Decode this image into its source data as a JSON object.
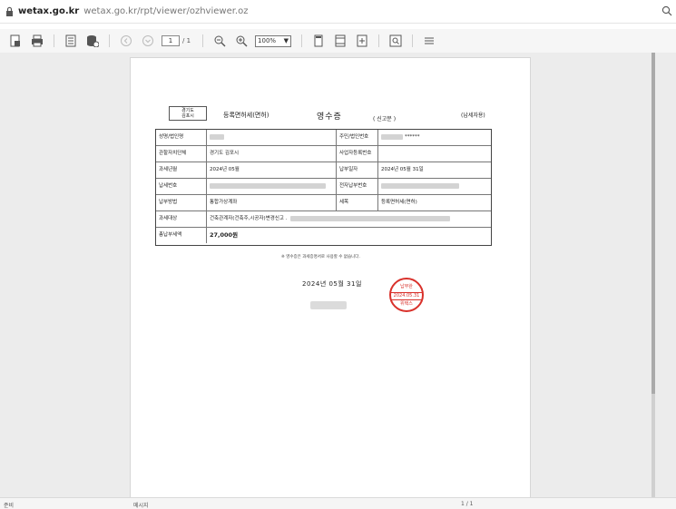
{
  "address_bar": {
    "host": "wetax.go.kr",
    "path": "wetax.go.kr/rpt/viewer/ozhviewer.oz"
  },
  "toolbar": {
    "icons": [
      "export-icon",
      "print-icon",
      "save-icon",
      "save-db-icon",
      "prev-page-icon",
      "next-page-icon",
      "zoom-out-icon",
      "zoom-in-icon",
      "single-page-icon",
      "two-page-icon",
      "fit-page-icon",
      "find-icon",
      "menu-icon"
    ],
    "page_current": "1",
    "page_total": "/ 1",
    "zoom": "100%"
  },
  "receipt": {
    "issuer_line1": "경기도",
    "issuer_line2": "김포시",
    "tax_name": "등록면허세(면허)",
    "title": "영수증",
    "subtitle": "( 신고분 )",
    "copy_type": "(납세자용)",
    "rows": [
      {
        "label": "성명/법인명",
        "value": "",
        "label2": "주민/법인번호",
        "value2": "******"
      },
      {
        "label": "관할자치단체",
        "value": "경기도 김포시",
        "label2": "사업자등록번호",
        "value2": ""
      },
      {
        "label": "과세년월",
        "value": "2024년 05월",
        "label2": "납부일자",
        "value2": "2024년 05월 31일"
      },
      {
        "label": "납세번호",
        "value": "",
        "label2": "전자납부번호",
        "value2": ""
      },
      {
        "label": "납부방법",
        "value": "통합가상계좌",
        "label2": "세목",
        "value2": "등록면허세(면허)"
      },
      {
        "label": "과세대상",
        "value": "건축관계자(건축주,시공자)변경신고 ."
      },
      {
        "label": "총납부세액",
        "value": "27,000원"
      }
    ],
    "note": "※ 영수증은 과세증명서로 사용할 수 없습니다.",
    "issue_date": "2024년 05월 31일",
    "seal": {
      "top": "납부완",
      "date": "2024.05.31",
      "bottom": "위택스"
    }
  },
  "status_bar": {
    "left": "준비",
    "message": "메시지",
    "page": "1 / 1"
  },
  "colors": {
    "seal": "#d9312b",
    "viewer_bg": "#ececec",
    "toolbar_bg": "#f6f6f6"
  }
}
